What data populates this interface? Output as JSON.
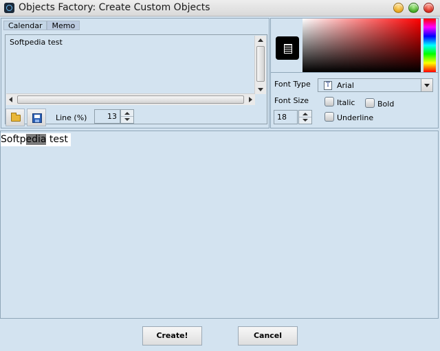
{
  "window": {
    "title": "Objects Factory: Create Custom Objects"
  },
  "left_panel": {
    "tabs": [
      {
        "label": "Calendar"
      },
      {
        "label": "Memo",
        "active": true
      }
    ],
    "memo_text": "Softpedia test",
    "toolbar": {
      "open_icon": "folder-open-icon",
      "save_icon": "floppy-disk-icon",
      "line_label": "Line (%)",
      "line_value": "13"
    }
  },
  "right_panel": {
    "selected_color": "#000000",
    "font_type_label": "Font Type",
    "font_type_value": "Arial",
    "font_size_label": "Font Size",
    "font_size_value": "18",
    "italic_label": "Italic",
    "bold_label": "Bold",
    "underline_label": "Underline",
    "italic_checked": false,
    "bold_checked": false,
    "underline_checked": false
  },
  "preview": {
    "text_before": "Softp",
    "text_highlight": "edia",
    "text_after": " test"
  },
  "buttons": {
    "create_label": "Create!",
    "cancel_label": "Cancel"
  }
}
